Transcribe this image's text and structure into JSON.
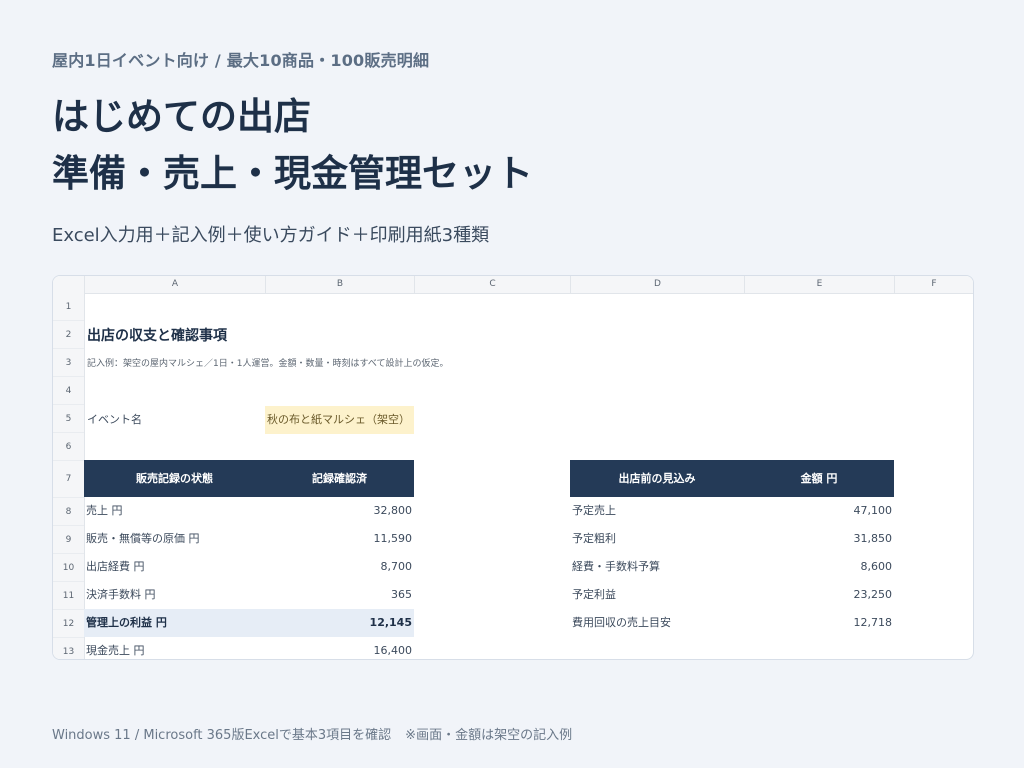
{
  "header": {
    "eyebrow": "屋内1日イベント向け / 最大10商品・100販売明細",
    "title_line1": "はじめての出店",
    "title_line2": "準備・売上・現金管理セット",
    "subtitle": "Excel入力用＋記入例＋使い方ガイド＋印刷用紙3種類"
  },
  "sheet": {
    "columns": [
      "A",
      "B",
      "C",
      "D",
      "E",
      "F"
    ],
    "rows": [
      "1",
      "2",
      "3",
      "4",
      "5",
      "6",
      "7",
      "8",
      "9",
      "10",
      "11",
      "12",
      "13"
    ],
    "title": "出店の収支と確認事項",
    "note": "記入例：架空の屋内マルシェ／1日・1人運営。金額・数量・時刻はすべて設計上の仮定。",
    "event_label": "イベント名",
    "event_value": "秋の布と紙マルシェ（架空）",
    "left_table": {
      "header_label": "販売記録の状態",
      "header_value": "記録確認済",
      "rows": [
        {
          "label": "売上 円",
          "value": "32,800"
        },
        {
          "label": "販売・無償等の原価 円",
          "value": "11,590"
        },
        {
          "label": "出店経費 円",
          "value": "8,700"
        },
        {
          "label": "決済手数料 円",
          "value": "365"
        },
        {
          "label": "管理上の利益 円",
          "value": "12,145"
        },
        {
          "label": "現金売上 円",
          "value": "16,400"
        }
      ]
    },
    "right_table": {
      "header_label": "出店前の見込み",
      "header_value": "金額 円",
      "rows": [
        {
          "label": "予定売上",
          "value": "47,100"
        },
        {
          "label": "予定粗利",
          "value": "31,850"
        },
        {
          "label": "経費・手数料予算",
          "value": "8,600"
        },
        {
          "label": "予定利益",
          "value": "23,250"
        },
        {
          "label": "費用回収の売上目安",
          "value": "12,718"
        }
      ]
    }
  },
  "footer": {
    "env": "Windows 11 / Microsoft 365版Excelで基本3項目を確認",
    "note": "※画面・金額は架空の記入例"
  }
}
